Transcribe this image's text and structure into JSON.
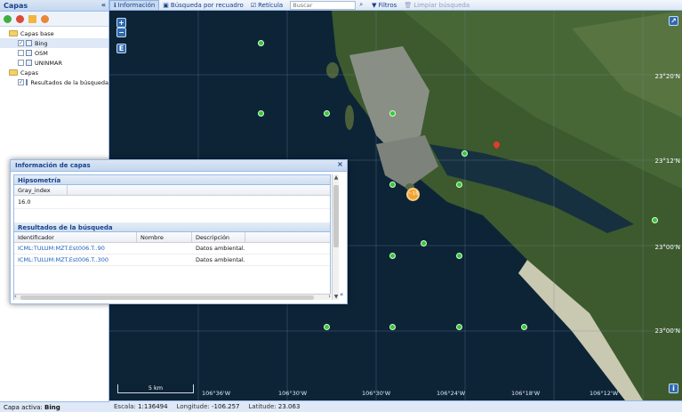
{
  "left_panel": {
    "title": "Capas",
    "collapse_glyph": "«",
    "toolbar_icons": [
      "add-icon",
      "remove-icon",
      "folder-icon",
      "settings-icon"
    ],
    "tree": {
      "base_folder": "Capas base",
      "base_layers": [
        {
          "label": "Bing",
          "checked": true
        },
        {
          "label": "OSM",
          "checked": false
        },
        {
          "label": "UNINMAR",
          "checked": false
        }
      ],
      "folder": "Capas",
      "layers": [
        {
          "label": "Resultados de la búsqueda",
          "checked": true
        }
      ]
    },
    "footer_label": "Capa activa:",
    "footer_value": "Bing"
  },
  "toolbar": {
    "info_label": "Información",
    "box_search_label": "Búsqueda por recuadro",
    "grid_label": "Retícula",
    "search_placeholder": "Buscar",
    "filters_label": "Filtros",
    "clear_label": "Limpiar búsqueda"
  },
  "map": {
    "zoom_in": "+",
    "zoom_out": "−",
    "extent_button": "E",
    "lat_labels": [
      "23°20'N",
      "23°12'N",
      "23°00'N",
      "23°00'N"
    ],
    "lon_labels": [
      "106°36'W",
      "106°30'W",
      "106°30'W",
      "106°24'W",
      "106°18'W",
      "106°12'W"
    ],
    "scale_label": "5 km",
    "cluster_count": "~15",
    "info_button": "i",
    "expand_button": "↗"
  },
  "status": {
    "scale_label": "Escala:",
    "scale_value": "1:136494",
    "lon_label": "Longitude:",
    "lon_value": "-106.257",
    "lat_label": "Latitude:",
    "lat_value": "23.063"
  },
  "popup": {
    "title": "Información de capas",
    "close_glyph": "×",
    "sections": {
      "hypsometry": {
        "title": "Hipsometría",
        "column": "Gray_index",
        "value": "16.0"
      },
      "results": {
        "title": "Resultados de la búsqueda",
        "columns": [
          "Identificador",
          "Nombre",
          "Descripción"
        ],
        "rows": [
          {
            "id": "ICML:TULUM:MZT.Est006.T..90",
            "name": "",
            "desc": "Datos ambiental..."
          },
          {
            "id": "ICML:TULUM:MZT.Est006.T..300",
            "name": "",
            "desc": "Datos ambiental..."
          }
        ]
      }
    },
    "collapse_glyph": "«"
  },
  "colors": {
    "panel_header": "#c4d6ef",
    "accent": "#15428b",
    "marker_green": "#36c836",
    "cluster_orange": "#f0a330",
    "pin_red": "#e23b2e",
    "sea": "#0d2437"
  }
}
